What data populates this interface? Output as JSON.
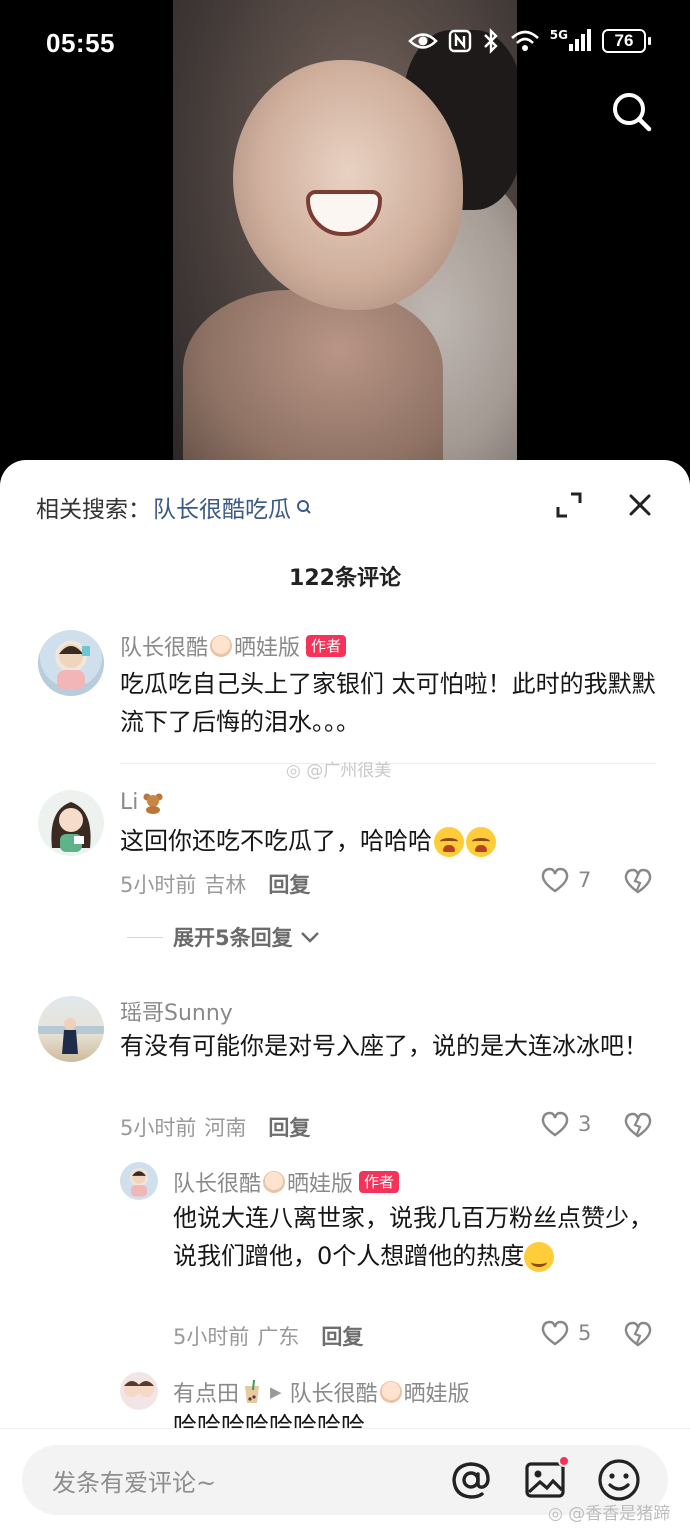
{
  "status_bar": {
    "time": "05:55",
    "network": "5G",
    "battery": "76",
    "icons": [
      "eye-icon",
      "nfc-icon",
      "bluetooth-icon",
      "wifi-icon",
      "signal-icon",
      "battery-icon"
    ]
  },
  "video": {
    "search_icon": "search-icon"
  },
  "sheet": {
    "related_label": "相关搜索：",
    "related_query": "队长很酷吃瓜",
    "comment_count_title": "122条评论",
    "expand_replies": "展开5条回复",
    "watermark_mid": "@广州很美",
    "watermark_bottom": "@香香是猪蹄"
  },
  "comments": [
    {
      "user_prefix": "队长很酷",
      "user_suffix": "晒娃版",
      "author_tag": "作者",
      "text": "吃瓜吃自己头上了家银们 太可怕啦！此时的我默默流下了后悔的泪水。。。"
    },
    {
      "user_prefix": "Li",
      "text": "这回你还吃不吃瓜了，哈哈哈",
      "time": "5小时前",
      "location": "吉林",
      "reply_label": "回复",
      "likes": "7"
    },
    {
      "user_prefix": "瑶哥Sunny",
      "text": "有没有可能你是对号入座了，说的是大连冰冰吧！",
      "time": "5小时前",
      "location": "河南",
      "reply_label": "回复",
      "likes": "3"
    },
    {
      "user_prefix": "队长很酷",
      "user_suffix": "晒娃版",
      "author_tag": "作者",
      "text": "他说大连八离世家，说我几百万粉丝点赞少，说我们蹭他，0个人想蹭他的热度",
      "time": "5小时前",
      "location": "广东",
      "reply_label": "回复",
      "likes": "5"
    },
    {
      "user_prefix": "有点田",
      "reply_to_prefix": "队长很酷",
      "reply_to_suffix": "晒娃版",
      "text": "哈哈哈哈哈哈哈哈"
    }
  ],
  "input": {
    "placeholder": "发条有爱评论~"
  },
  "colors": {
    "accent_link": "#3b5a86",
    "author_tag": "#f5325a"
  }
}
